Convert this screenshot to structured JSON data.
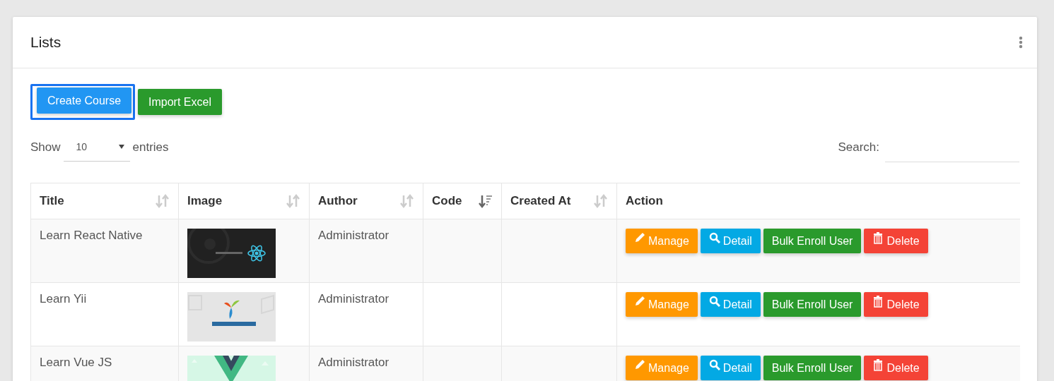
{
  "card": {
    "title": "Lists"
  },
  "toolbar": [
    {
      "label": "Create Course",
      "kind": "primary",
      "focused": true
    },
    {
      "label": "Import Excel",
      "kind": "success",
      "focused": false
    }
  ],
  "length": {
    "before": "Show",
    "value": "10",
    "after": "entries"
  },
  "search": {
    "label": "Search:"
  },
  "table": {
    "columns": [
      {
        "label": "Title",
        "sorted": false
      },
      {
        "label": "Image",
        "sorted": false
      },
      {
        "label": "Author",
        "sorted": false
      },
      {
        "label": "Code",
        "sorted": true
      },
      {
        "label": "Created At",
        "sorted": false
      },
      {
        "label": "Action"
      }
    ],
    "rows": [
      {
        "title": "Learn React Native",
        "author": "Administrator",
        "actions": [
          {
            "label": "Manage",
            "kind": "manage"
          },
          {
            "label": "Detail",
            "kind": "detail"
          },
          {
            "label": "Bulk Enroll User",
            "kind": "enroll"
          },
          {
            "label": "Delete",
            "kind": "delete"
          }
        ]
      },
      {
        "title": "Learn Yii",
        "author": "Administrator",
        "actions": [
          {
            "label": "Manage",
            "kind": "manage"
          },
          {
            "label": "Detail",
            "kind": "detail"
          },
          {
            "label": "Bulk Enroll User",
            "kind": "enroll"
          },
          {
            "label": "Delete",
            "kind": "delete"
          }
        ]
      },
      {
        "title": "Learn Vue JS",
        "author": "Administrator",
        "actions": [
          {
            "label": "Manage",
            "kind": "manage"
          },
          {
            "label": "Detail",
            "kind": "detail"
          },
          {
            "label": "Bulk Enroll User",
            "kind": "enroll"
          },
          {
            "label": "Delete",
            "kind": "delete"
          }
        ]
      }
    ]
  }
}
